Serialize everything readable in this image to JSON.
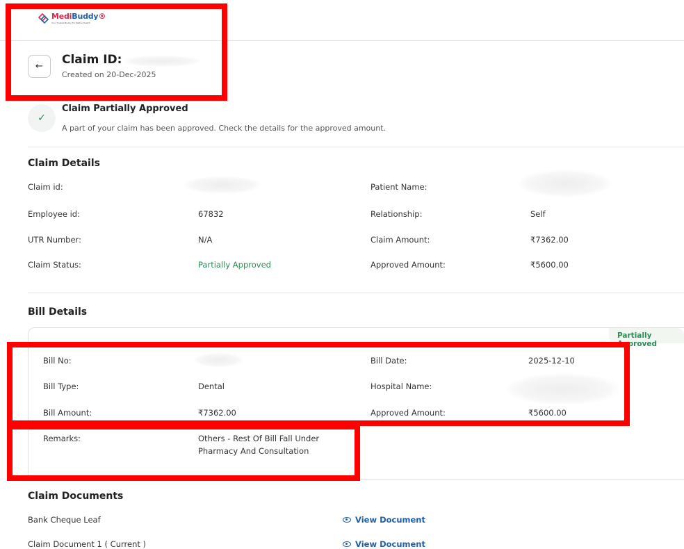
{
  "logo": {
    "name_a": "Medi",
    "name_b": "Buddy",
    "tagline": "Your Trusted Buddy For Better Health"
  },
  "header": {
    "claim_label": "Claim ID:",
    "created": "Created on 20-Dec-2025",
    "back_icon": "arrow-left-icon"
  },
  "status": {
    "icon": "check-icon",
    "title": "Claim Partially Approved",
    "description": "A part of your claim has been approved. Check the details for the approved amount."
  },
  "claim_details": {
    "title": "Claim Details",
    "claim_id_label": "Claim id:",
    "patient_name_label": "Patient Name:",
    "employee_id_label": "Employee id:",
    "employee_id": "67832",
    "relationship_label": "Relationship:",
    "relationship": "Self",
    "utr_label": "UTR Number:",
    "utr": "N/A",
    "claim_amount_label": "Claim Amount:",
    "claim_amount": "₹7362.00",
    "claim_status_label": "Claim Status:",
    "claim_status": "Partially Approved",
    "approved_amount_label": "Approved Amount:",
    "approved_amount": "₹5600.00"
  },
  "bill_details": {
    "title": "Bill Details",
    "status_chip": "Partially Approved",
    "bill_no_label": "Bill No:",
    "bill_date_label": "Bill Date:",
    "bill_date": "2025-12-10",
    "bill_type_label": "Bill Type:",
    "bill_type": "Dental",
    "hospital_name_label": "Hospital Name:",
    "bill_amount_label": "Bill Amount:",
    "bill_amount": "₹7362.00",
    "approved_amount_label": "Approved Amount:",
    "approved_amount": "₹5600.00",
    "remarks_label": "Remarks:",
    "remarks_line1": "Others - Rest Of Bill Fall Under",
    "remarks_line2": "Pharmacy And Consultation"
  },
  "claim_documents": {
    "title": "Claim Documents",
    "items": [
      {
        "name": "Bank Cheque Leaf",
        "action": "View Document"
      },
      {
        "name": "Claim Document 1 ( Current )",
        "action": "View Document"
      }
    ]
  },
  "highlight_color": "#ff0000",
  "accent_green": "#2e8b57",
  "link_blue": "#1f5fa8"
}
